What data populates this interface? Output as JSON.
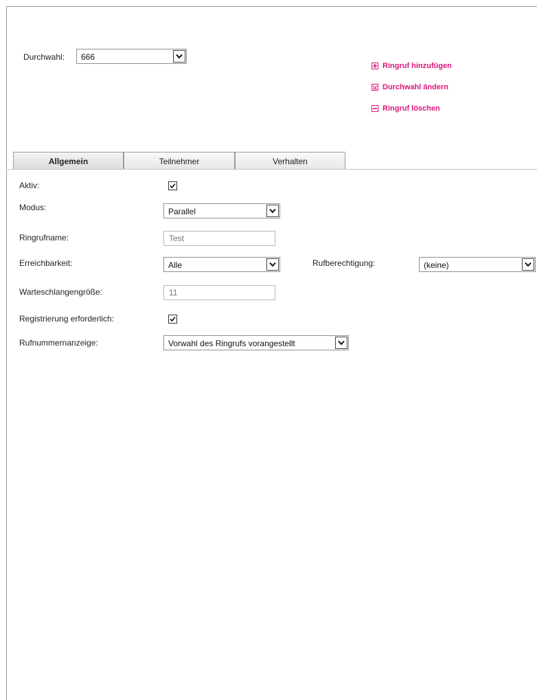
{
  "header": {
    "extension_label": "Durchwahl:",
    "extension_value": "666"
  },
  "actions": {
    "add_ring": "Ringruf hinzufügen",
    "change_extension": "Durchwahl ändern",
    "delete_ring": "Ringruf löschen"
  },
  "tabs": [
    {
      "label": "Allgemein",
      "active": true
    },
    {
      "label": "Teilnehmer",
      "active": false
    },
    {
      "label": "Verhalten",
      "active": false
    }
  ],
  "form": {
    "active_label": "Aktiv:",
    "active_checked": true,
    "mode_label": "Modus:",
    "mode_value": "Parallel",
    "ringname_label": "Ringrufname:",
    "ringname_value": "Test",
    "reachability_label": "Erreichbarkeit:",
    "reachability_value": "Alle",
    "permission_label": "Rufberechtigung:",
    "permission_value": "(keine)",
    "queue_label": "Warteschlangengröße:",
    "queue_value": "11",
    "registration_label": "Registrierung erforderlich:",
    "registration_checked": true,
    "display_label": "Rufnummernanzeige:",
    "display_value": "Vorwahl des Ringrufs vorangestellt"
  },
  "colors": {
    "accent": "#e0147c"
  }
}
